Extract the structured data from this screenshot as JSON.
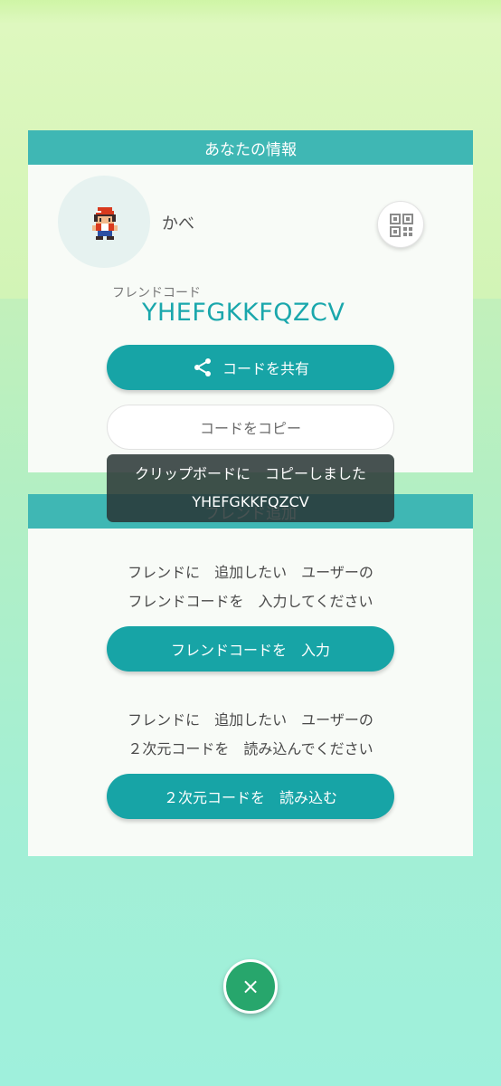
{
  "info_panel": {
    "title": "あなたの情報",
    "username": "かべ",
    "friend_code_label": "フレンドコード",
    "friend_code": "YHEFGKKFQZCV",
    "share_button": "コードを共有",
    "copy_button": "コードをコピー"
  },
  "add_panel": {
    "title": "フレンド追加",
    "instruction_code_line1": "フレンドに　追加したい　ユーザーの",
    "instruction_code_line2": "フレンドコードを　入力してください",
    "enter_code_button": "フレンドコードを　入力",
    "instruction_qr_line1": "フレンドに　追加したい　ユーザーの",
    "instruction_qr_line2": "２次元コードを　読み込んでください",
    "scan_qr_button": "２次元コードを　読み込む"
  },
  "toast": {
    "line1": "クリップボードに　コピーしました",
    "line2": "YHEFGKKFQZCV"
  },
  "close_button": "×",
  "icons": {
    "avatar": "trainer-sprite-icon",
    "qr": "qr-code-icon",
    "share": "share-icon",
    "close": "close-icon"
  },
  "colors": {
    "header": "#3fb7b4",
    "primary_button": "#17a4a6",
    "friend_code": "#1aa7ac",
    "close_button": "#27a66c"
  }
}
